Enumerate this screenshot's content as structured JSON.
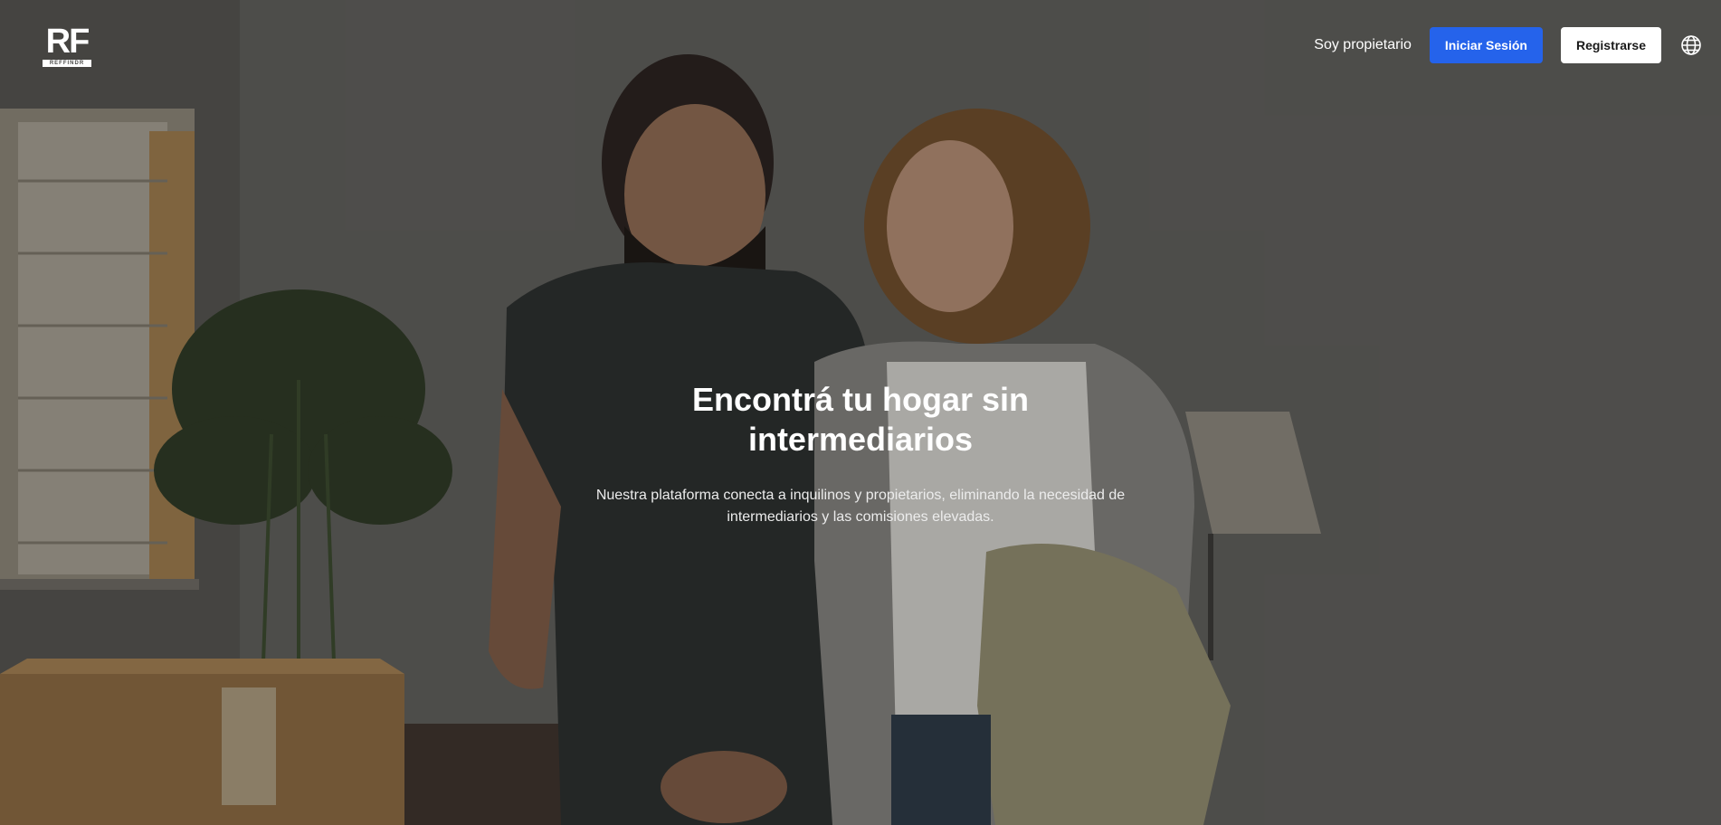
{
  "header": {
    "logo_text": "RF",
    "logo_subtext": "REFFINDR",
    "owner_link": "Soy propietario",
    "login_button": "Iniciar Sesión",
    "register_button": "Registrarse",
    "language_icon": "globe-icon"
  },
  "hero": {
    "title": "Encontrá tu hogar sin intermediarios",
    "description": "Nuestra plataforma conecta a inquilinos y propietarios, eliminando la necesidad de intermediarios y las comisiones elevadas."
  },
  "colors": {
    "primary": "#2563eb",
    "text": "#ffffff"
  }
}
